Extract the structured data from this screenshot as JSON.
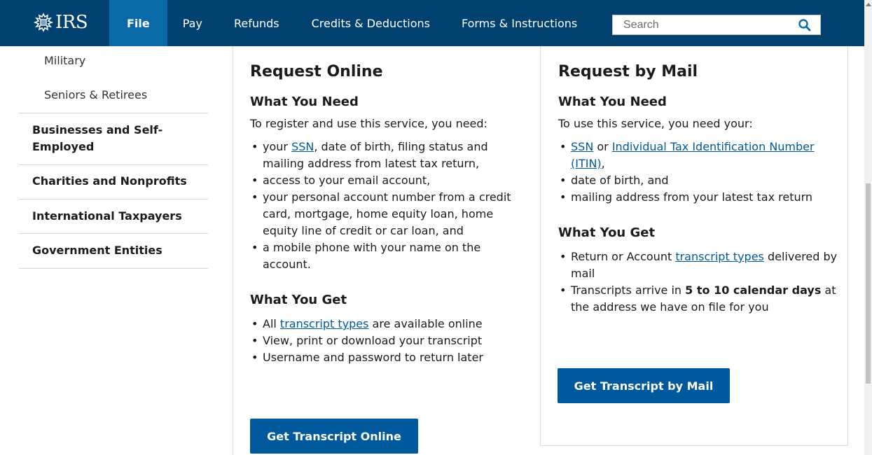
{
  "header": {
    "logo_text": "IRS",
    "nav": [
      "File",
      "Pay",
      "Refunds",
      "Credits & Deductions",
      "Forms & Instructions"
    ],
    "active_nav": "File",
    "search_placeholder": "Search"
  },
  "sidebar": {
    "sub_items": [
      "Military",
      "Seniors & Retirees"
    ],
    "main_items": [
      "Businesses and Self-Employed",
      "Charities and Nonprofits",
      "International Taxpayers",
      "Government Entities"
    ]
  },
  "online": {
    "title": "Request Online",
    "need_heading": "What You Need",
    "need_lead": "To register and use this service, you need:",
    "need_items": {
      "i1_pre": "your ",
      "i1_link": "SSN",
      "i1_post": ", date of birth, filing status and mailing address from latest tax return,",
      "i2": "access to your email account,",
      "i3": "your personal account number from a credit card, mortgage, home equity loan, home equity line of credit or car loan, and",
      "i4": "a mobile phone with your name on the account."
    },
    "get_heading": "What You Get",
    "get_items": {
      "i1_pre": "All ",
      "i1_link": "transcript types",
      "i1_post": " are available online",
      "i2": "View, print or download your transcript",
      "i3": "Username and password to return later"
    },
    "button": "Get Transcript Online"
  },
  "mail": {
    "title": "Request by Mail",
    "need_heading": "What You Need",
    "need_lead": "To use this service, you need your:",
    "need_items": {
      "i1_link1": "SSN",
      "i1_mid": " or ",
      "i1_link2": "Individual Tax Identification Number (ITIN)",
      "i1_post": ",",
      "i2": "date of birth, and",
      "i3": "mailing address from your latest tax return"
    },
    "get_heading": "What You Get",
    "get_items": {
      "i1_pre": "Return or Account ",
      "i1_link": "transcript types",
      "i1_post": " delivered by mail",
      "i2_pre": "Transcripts arrive in ",
      "i2_bold": "5 to 10 calendar days",
      "i2_post": " at the address we have on file for you"
    },
    "button": "Get Transcript by Mail"
  },
  "colors": {
    "header_bg": "#00416f",
    "active_tab": "#0a6aa7",
    "button_bg": "#00599c",
    "link": "#00599c"
  }
}
